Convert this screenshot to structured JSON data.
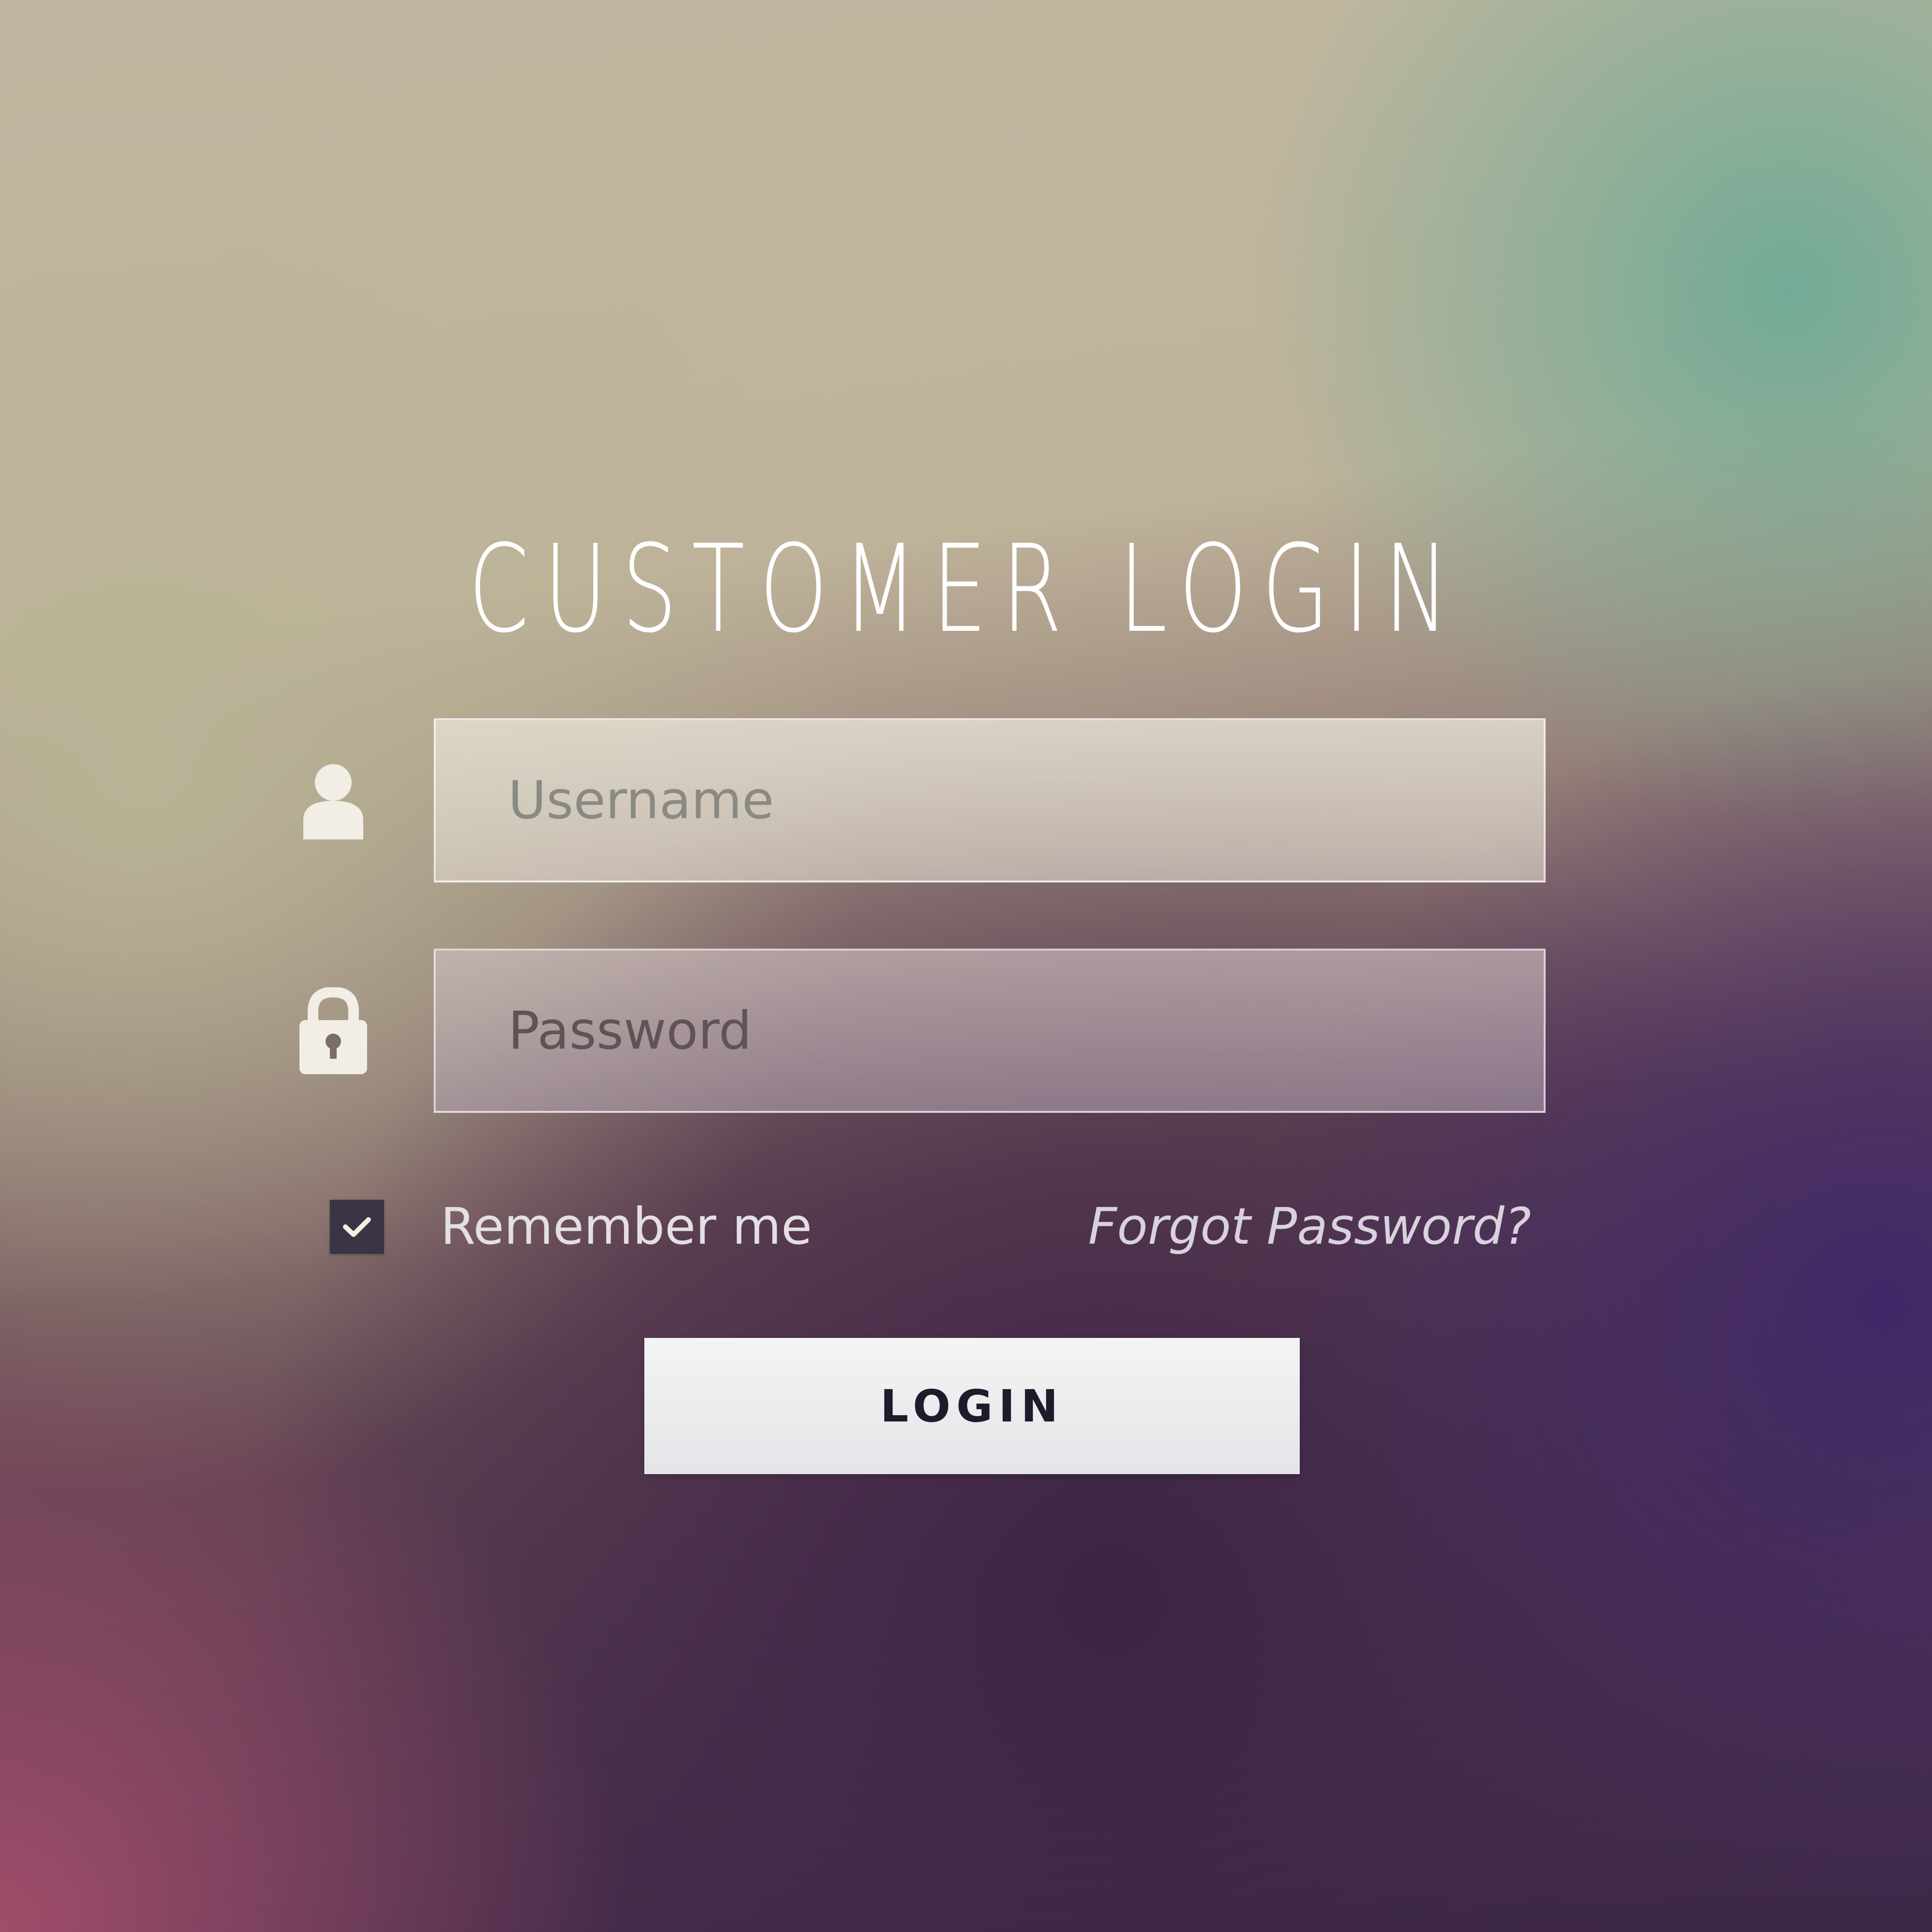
{
  "login": {
    "title": "CUSTOMER LOGIN",
    "username": {
      "placeholder": "Username",
      "icon": "user-icon"
    },
    "password": {
      "placeholder": "Password",
      "icon": "lock-icon"
    },
    "remember_me": {
      "label": "Remember me",
      "checked": true
    },
    "forgot_password": "Forgot Password?",
    "submit_label": "LOGIN"
  },
  "colors": {
    "icon": "#f2eee6",
    "checkbox_bg": "#3a3444",
    "button_bg": "#f0f0f2",
    "button_text": "#1e1b2a"
  }
}
